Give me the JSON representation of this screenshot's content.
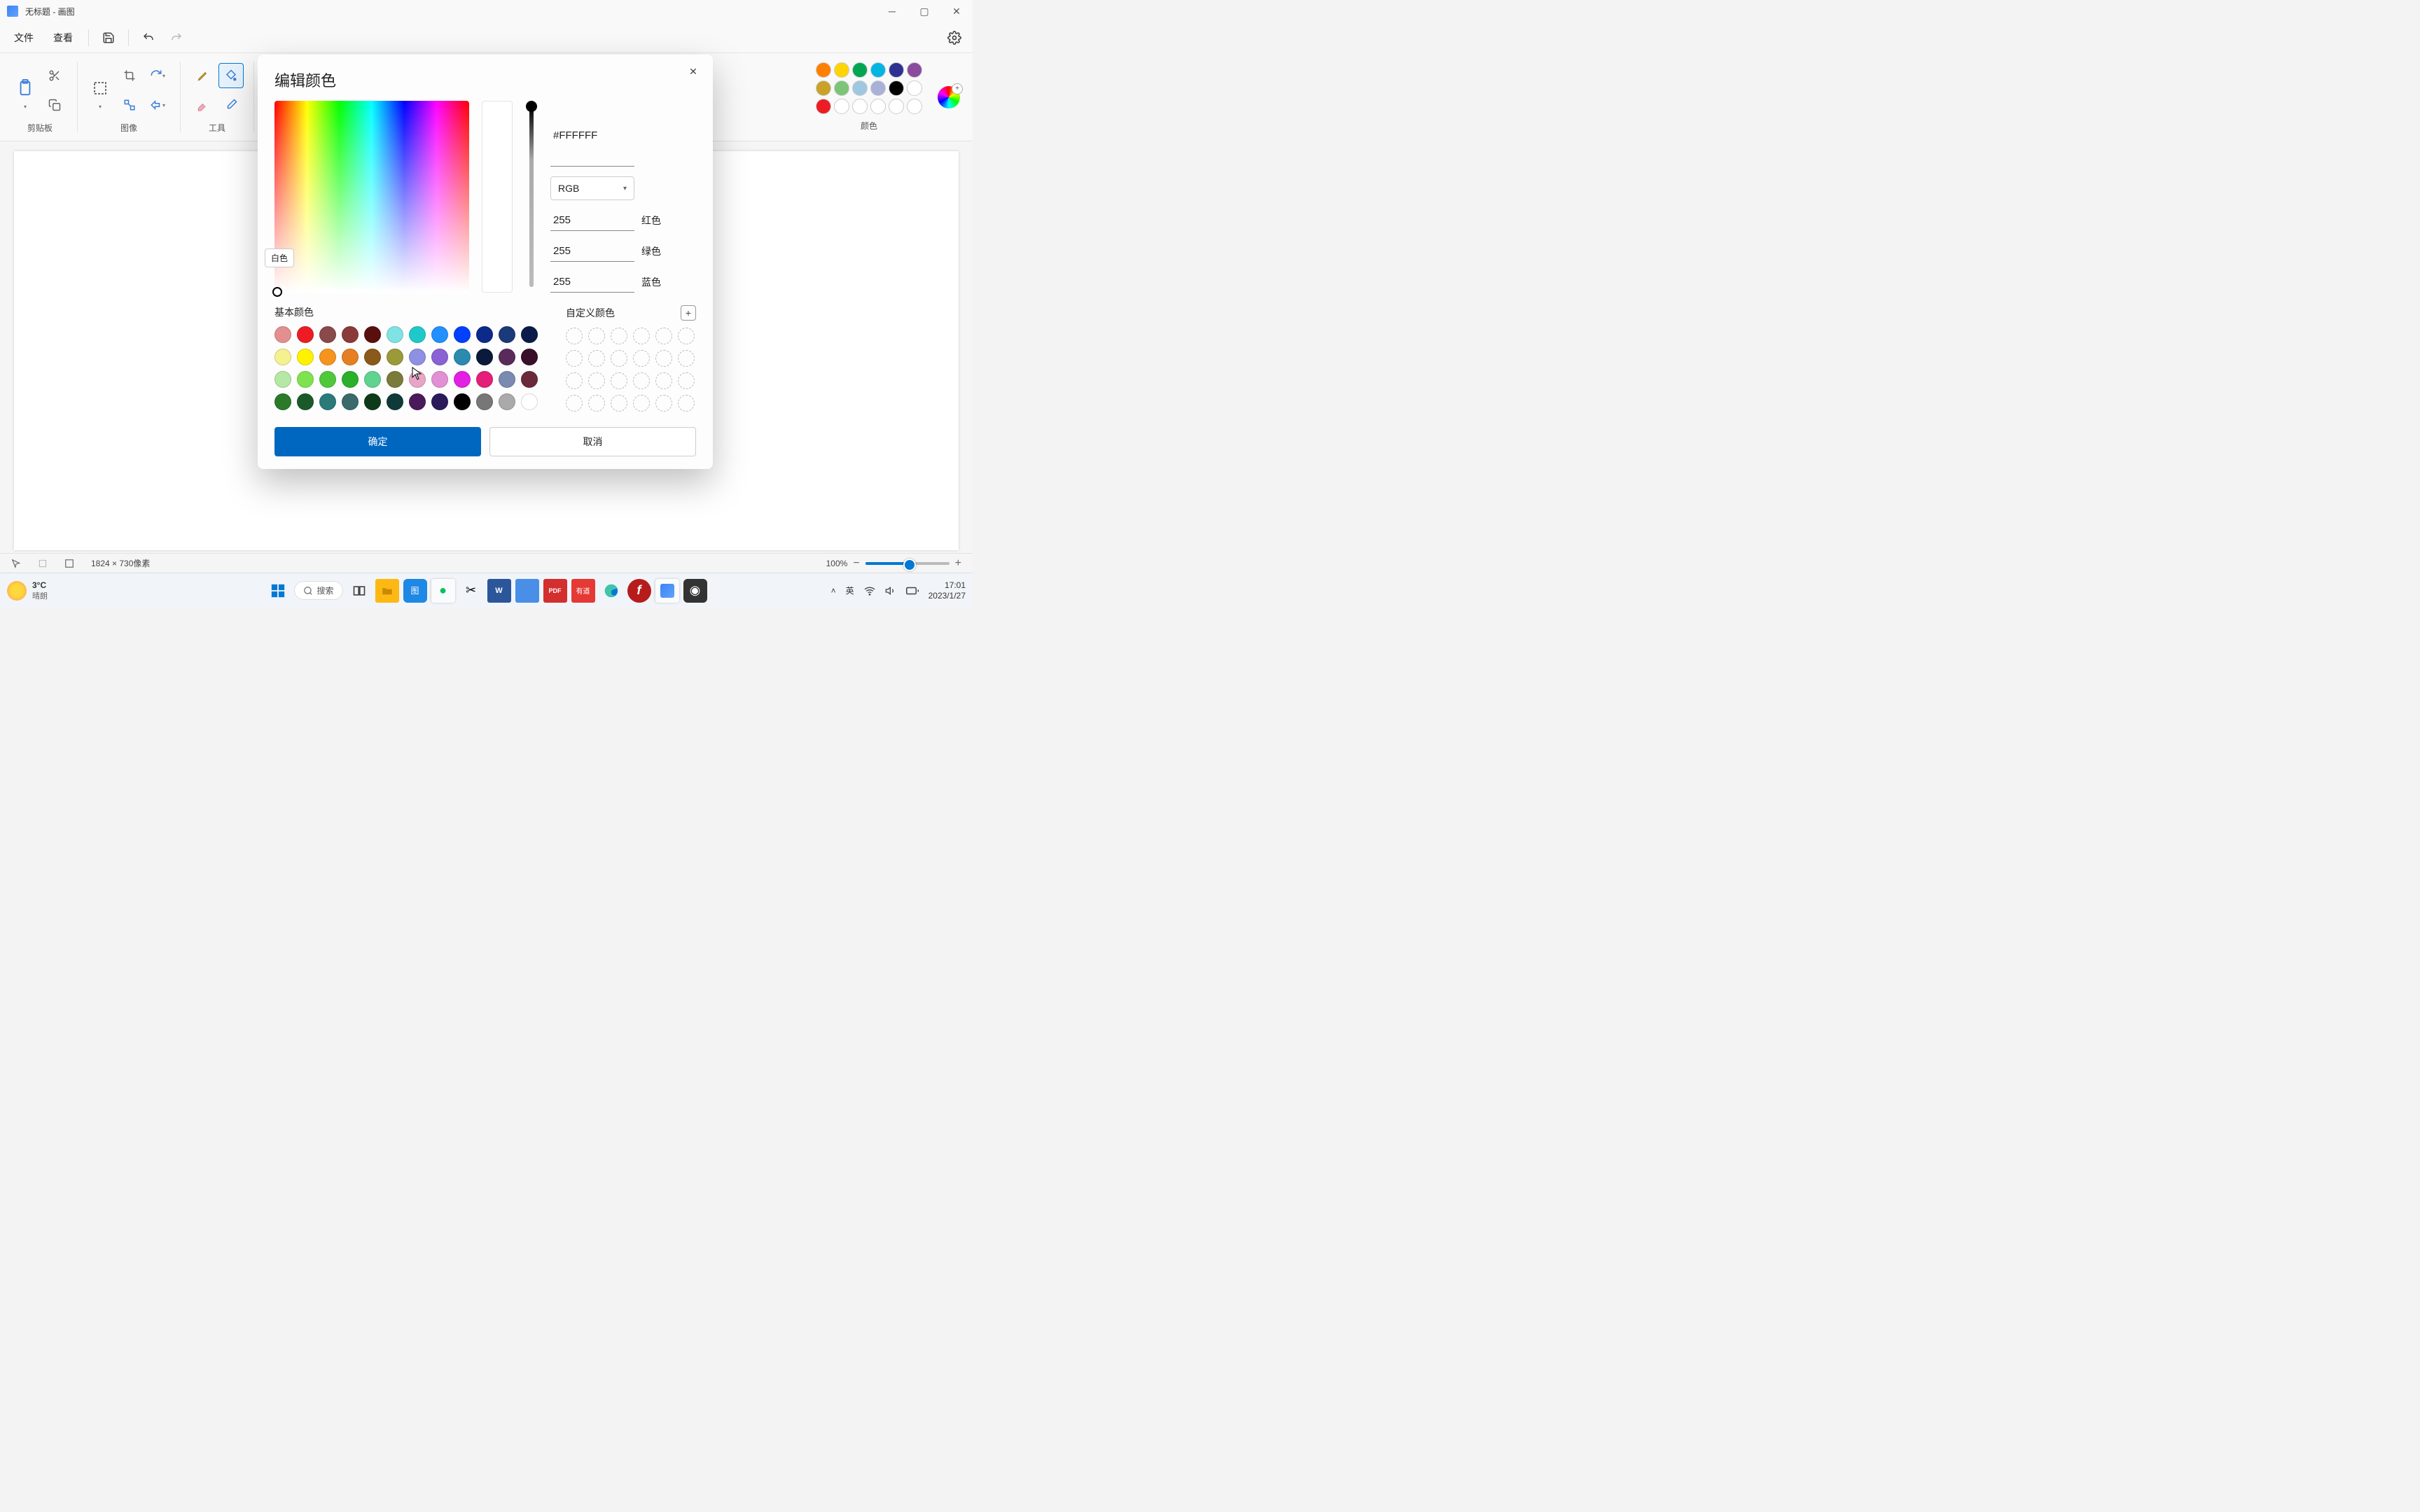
{
  "titlebar": {
    "title": "无标题 - 画图"
  },
  "menubar": {
    "file": "文件",
    "view": "查看"
  },
  "ribbon": {
    "clipboard_label": "剪贴板",
    "image_label": "图像",
    "tools_label": "工具",
    "colors_label": "颜色"
  },
  "ribbon_palette": [
    "#ff7f00",
    "#ffd400",
    "#00a651",
    "#00b5e2",
    "#2e3192",
    "#8a4b9e",
    "#c9a227",
    "#7cc576",
    "#9ec8e0",
    "#a9b1d9",
    "#000000",
    "#ffffff",
    "#ed1c24",
    "#ffffff",
    "#ffffff",
    "#ffffff",
    "#ffffff",
    "#ffffff"
  ],
  "statusbar": {
    "dim": "1824 × 730像素",
    "zoom": "100%"
  },
  "dialog": {
    "title": "编辑颜色",
    "hex": "#FFFFFF",
    "mode": "RGB",
    "r": "255",
    "g": "255",
    "b": "255",
    "r_label": "红色",
    "g_label": "绿色",
    "b_label": "蓝色",
    "tooltip": "白色",
    "basic_label": "基本颜色",
    "custom_label": "自定义颜色",
    "ok": "确定",
    "cancel": "取消",
    "basic_colors": [
      "#e38f8f",
      "#ed1c24",
      "#8b4a4a",
      "#8b3a3a",
      "#5a0f0f",
      "#7fe3e3",
      "#1fc9c9",
      "#2291ff",
      "#0040ff",
      "#0b2a8a",
      "#1a3a7a",
      "#0a1a4a",
      "#f5f18f",
      "#fff200",
      "#f7941e",
      "#e67e22",
      "#8a5a1a",
      "#9a9a3a",
      "#8f8fe3",
      "#8a62d4",
      "#2a8ab0",
      "#0b1a3a",
      "#5a2a5a",
      "#3a0f2a",
      "#b5e8a5",
      "#7fe34f",
      "#4fc93a",
      "#2ab02a",
      "#5fd48f",
      "#7a7a3a",
      "#e8a5c5",
      "#e38fd4",
      "#e31fe3",
      "#e31f7a",
      "#7a8ab0",
      "#6a2a3a",
      "#2a7a2a",
      "#1a5a2a",
      "#2a7a7a",
      "#3a6a6a",
      "#0f3a1a",
      "#0f3a3a",
      "#4a1a5a",
      "#2a1a5a",
      "#000000",
      "#777777",
      "#aaaaaa",
      "#ffffff"
    ]
  },
  "taskbar": {
    "temp": "3°C",
    "cond": "晴朗",
    "search": "搜索",
    "ime": "英",
    "time": "17:01",
    "date": "2023/1/27"
  }
}
